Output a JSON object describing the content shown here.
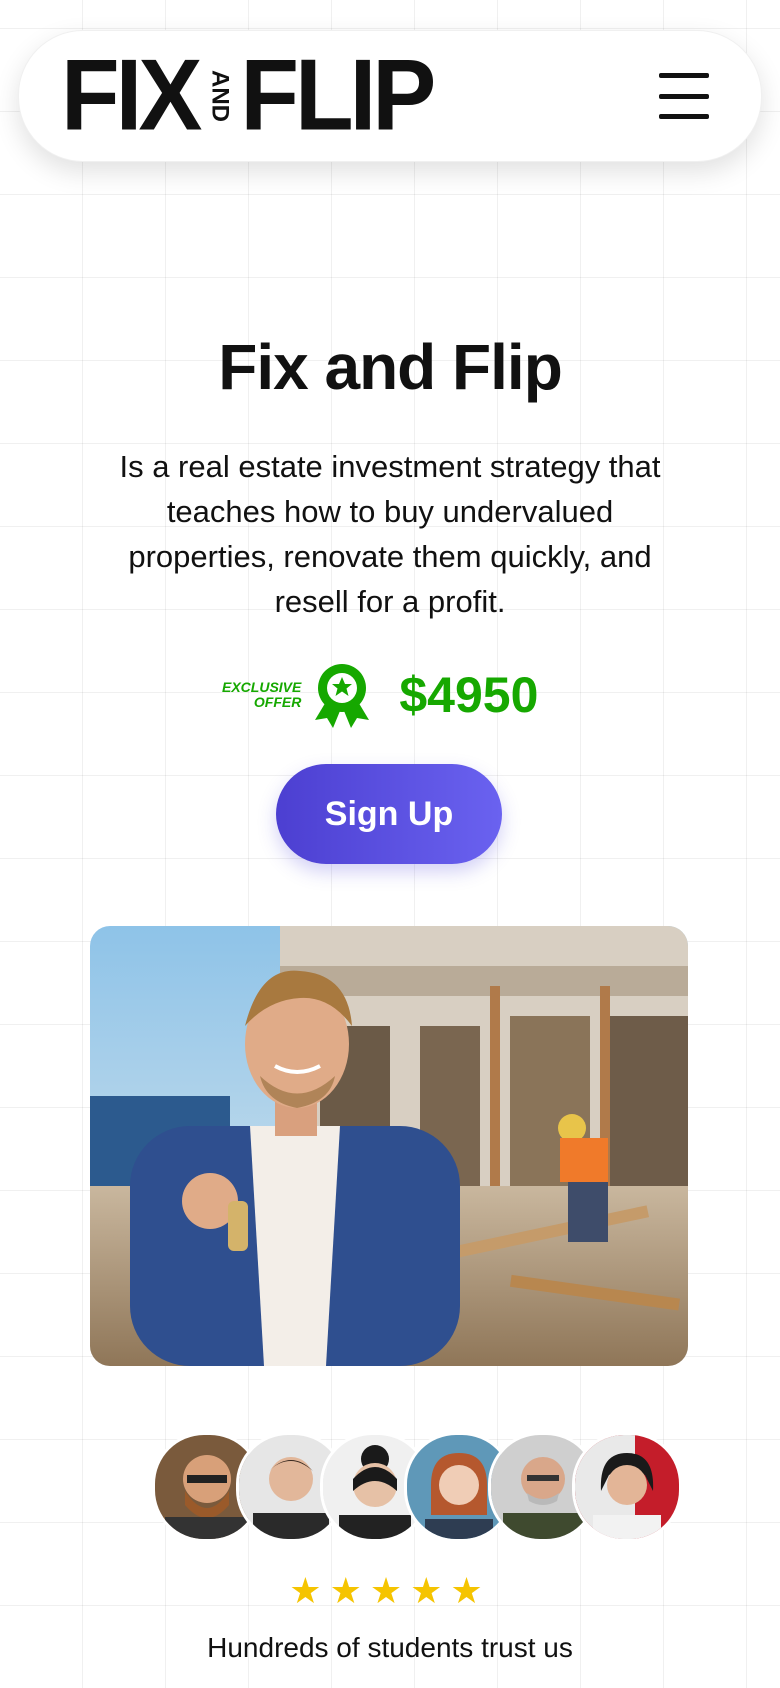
{
  "header": {
    "logo_left": "FIX",
    "logo_middle": "AND",
    "logo_right": "FLIP"
  },
  "hero": {
    "title": "Fix and Flip",
    "description": "Is a real estate investment strategy that teaches how to buy undervalued properties, renovate them quickly, and resell for a profit.",
    "offer_label_line1": "EXCLUSIVE",
    "offer_label_line2": "OFFER",
    "price": "$4950",
    "signup_label": "Sign Up"
  },
  "social_proof": {
    "rating_stars": 5,
    "caption": "Hundreds of students trust us"
  },
  "colors": {
    "accent_green": "#16a800",
    "button_gradient_start": "#4c3fd1",
    "button_gradient_end": "#6a62f0",
    "star": "#f5c400"
  }
}
